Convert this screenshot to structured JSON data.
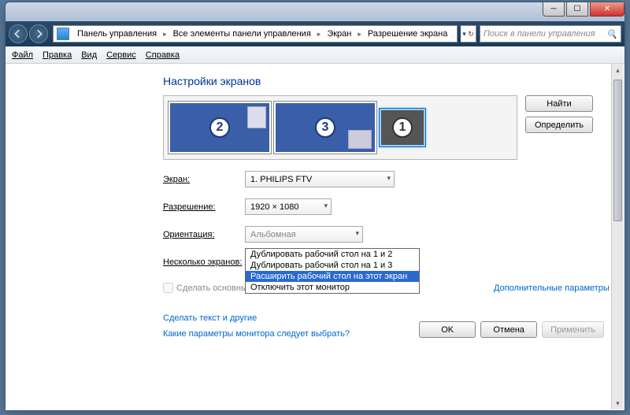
{
  "breadcrumb": {
    "items": [
      "Панель управления",
      "Все элементы панели управления",
      "Экран",
      "Разрешение экрана"
    ]
  },
  "search": {
    "placeholder": "Поиск в панели управления"
  },
  "menu": {
    "file": "Файл",
    "edit": "Правка",
    "view": "Вид",
    "tools": "Сервис",
    "help": "Справка"
  },
  "heading": "Настройки экранов",
  "monitors": {
    "m1": "1",
    "m2": "2",
    "m3": "3"
  },
  "buttons": {
    "find": "Найти",
    "detect": "Определить",
    "ok": "OK",
    "cancel": "Отмена",
    "apply": "Применить"
  },
  "labels": {
    "screen": "Экран:",
    "resolution": "Разрешение:",
    "orientation": "Ориентация:",
    "multi": "Несколько экранов:",
    "primary": "Сделать основным",
    "advanced": "Дополнительные параметры"
  },
  "values": {
    "screen": "1. PHILIPS FTV",
    "resolution": "1920 × 1080",
    "orientation": "Альбомная",
    "multi": "Отключить этот монитор"
  },
  "dropdown_options": {
    "o1": "Дублировать рабочий стол на 1 и 2",
    "o2": "Дублировать рабочий стол на 1 и 3",
    "o3": "Расширить рабочий стол на этот экран",
    "o4": "Отключить этот монитор"
  },
  "links": {
    "text_size": "Сделать текст и другие",
    "which_monitor": "Какие параметры монитора следует выбрать?"
  }
}
